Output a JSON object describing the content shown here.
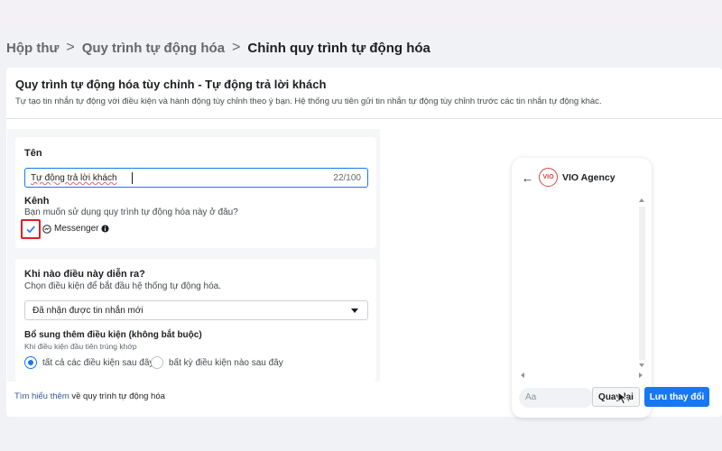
{
  "breadcrumb": {
    "items": [
      "Hộp thư",
      "Quy trình tự động hóa",
      "Chỉnh quy trình tự động hóa"
    ],
    "separator": ">"
  },
  "header": {
    "title": "Quy trình tự động hóa tùy chỉnh - Tự động trả lời khách",
    "description": "Tự tạo tin nhắn tự động với điều kiện và hành động tùy chỉnh theo ý bạn. Hệ thống ưu tiên gửi tin nhắn tự động tùy chỉnh trước các tin nhắn tự động khác."
  },
  "name_section": {
    "label": "Tên",
    "value": "Tự động trả lời khách",
    "counter": "22/100"
  },
  "channel_section": {
    "label": "Kênh",
    "question": "Bạn muốn sử dụng quy trình tự động hóa này ở đâu?",
    "option_label": "Messenger",
    "checked": true
  },
  "trigger_section": {
    "title": "Khi nào điều này diễn ra?",
    "subtitle": "Chọn điều kiện để bắt đầu hệ thống tự động hóa.",
    "selected": "Đã nhận được tin nhắn mới",
    "extra_title": "Bổ sung thêm điều kiện (không bắt buộc)",
    "extra_hint": "Khi điều kiện đầu tiên trùng khớp",
    "radio_all": "tất cả các điều kiện sau đây",
    "radio_any": "bất kỳ điều kiện nào sau đây"
  },
  "footer": {
    "link": "Tìm hiểu thêm",
    "text": " về quy trình tự động hóa"
  },
  "preview": {
    "page_name": "VIO Agency",
    "avatar_text": "VIO",
    "input_placeholder": "Aa"
  },
  "buttons": {
    "back": "Quay lại",
    "save": "Lưu thay đổi"
  },
  "colors": {
    "accent": "#1877f2",
    "highlight": "#e02020"
  }
}
